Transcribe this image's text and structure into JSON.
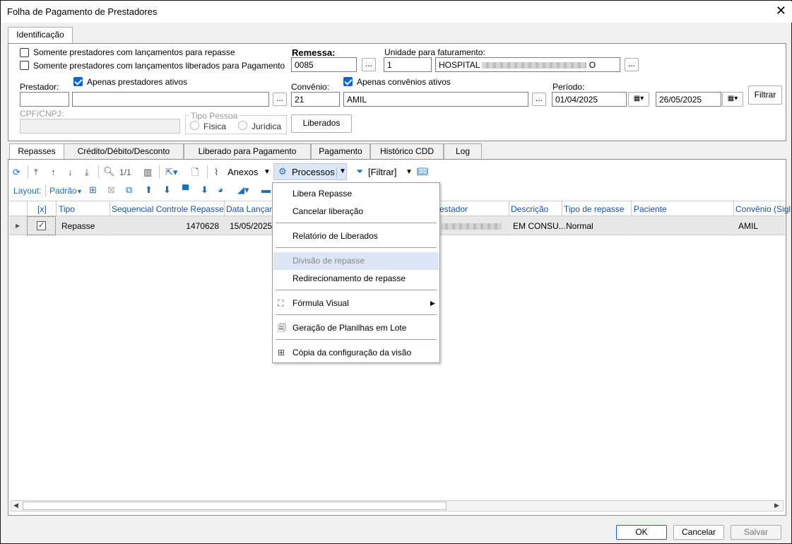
{
  "window": {
    "title": "Folha de Pagamento de Prestadores",
    "close": "✕"
  },
  "top_tab": "Identificação",
  "filters": {
    "only_with_entries": "Somente prestadores com lançamentos para repasse",
    "only_released": "Somente prestadores com lançamentos liberados para Pagamento",
    "remessa_label": "Remessa:",
    "remessa_value": "0085",
    "unidade_label": "Unidade para faturamento:",
    "unidade_code": "1",
    "unidade_name_prefix": "HOSPITAL",
    "unidade_name_suffix": "O",
    "prestador_label": "Prestador:",
    "apenas_prestadores": "Apenas prestadores ativos",
    "convenio_label": "Convênio:",
    "apenas_convenios": "Apenas convênios ativos",
    "convenio_code": "21",
    "convenio_name": "AMIL",
    "periodo_label": "Período:",
    "periodo_de": "01/04/2025",
    "periodo_ate": "26/05/2025",
    "filtrar_btn": "Filtrar",
    "cpf_label": "CPF/CNPJ:",
    "tipo_pessoa_label": "Tipo Pessoa",
    "fisica": "Física",
    "juridica": "Jurídica",
    "liberados_btn": "Liberados",
    "dots": "..."
  },
  "tabs": [
    "Repasses",
    "Crédito/Débito/Desconto",
    "Liberado para Pagamento",
    "Pagamento",
    "Histórico CDD",
    "Log"
  ],
  "toolbar": {
    "page": "1/1",
    "anexos": "Anexos",
    "processos": "Processos",
    "filtrar": "[Filtrar]",
    "layout_label": "Layout:",
    "layout_value": "Padrão"
  },
  "grid": {
    "headers": [
      "[x]",
      "Tipo",
      "Sequencial Controle Repasse",
      "Data Lançame",
      "estador",
      "Descrição",
      "Tipo de repasse",
      "Paciente",
      "Convênio (Sigl"
    ],
    "row": {
      "tipo": "Repasse",
      "sequencial": "1470628",
      "data": "15/05/2025",
      "descricao": "EM CONSU...",
      "tipo_repasse": "Normal",
      "convenio": "AMIL"
    }
  },
  "menu": {
    "items": [
      "Libera Repasse",
      "Cancelar liberação",
      "Relatório de Liberados",
      "Divisão de repasse",
      "Redirecionamento de repasse",
      "Fórmula Visual",
      "Geração de Planilhas em Lote",
      "Cópia da configuração da visão"
    ]
  },
  "footer": {
    "ok": "OK",
    "cancelar": "Cancelar",
    "salvar": "Salvar"
  },
  "colors": {
    "accent": "#0a64d8",
    "header_text": "#1a4f9c",
    "menu_highlight": "#dce6f5"
  }
}
